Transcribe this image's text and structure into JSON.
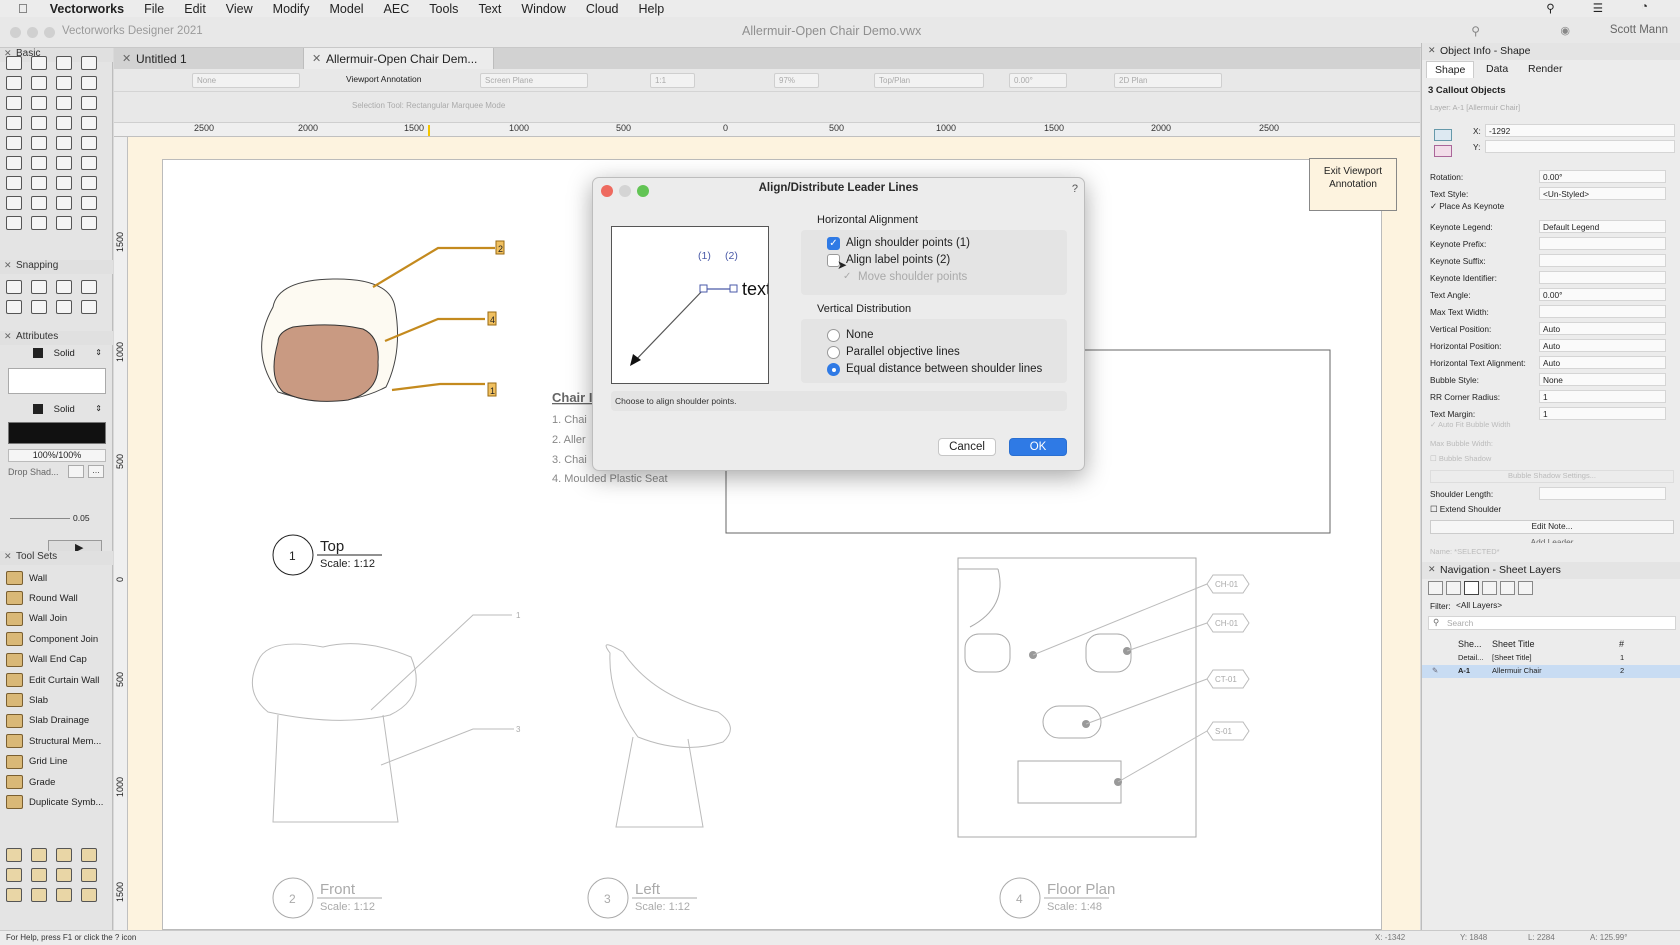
{
  "menubar": {
    "app": "Vectorworks",
    "items": [
      "File",
      "Edit",
      "View",
      "Modify",
      "Model",
      "AEC",
      "Tools",
      "Text",
      "Window",
      "Cloud",
      "Help"
    ]
  },
  "titlebar": {
    "app_title": "Vectorworks Designer 2021",
    "doc_title": "Allermuir-Open Chair Demo.vwx",
    "user": "Scott Mann"
  },
  "tabs": [
    "Untitled 1",
    "Allermuir-Open Chair Dem..."
  ],
  "toolbar": {
    "class_field": "None",
    "viewport_annotation": "Viewport Annotation",
    "plane_field": "Screen Plane",
    "scale_field": "1:1",
    "zoom_field": "97%",
    "view_field": "Top/Plan",
    "rotation_field": "0.00°",
    "render_field": "2D Plan",
    "mode_text": "Selection Tool: Rectangular Marquee Mode"
  },
  "ruler": {
    "h": [
      "2500",
      "2000",
      "1500",
      "1000",
      "500",
      "0",
      "500",
      "1000",
      "1500",
      "2000",
      "2500"
    ],
    "v": [
      "1500",
      "1000",
      "500",
      "0",
      "500",
      "1000",
      "1500"
    ]
  },
  "left_palette": {
    "basic_title": "Basic",
    "snapping_title": "Snapping",
    "attributes_title": "Attributes",
    "fill_style": "Solid",
    "pen_style": "Solid",
    "opacity": "100%/100%",
    "drop_shadow": "Drop Shad...",
    "line_weight": "0.05",
    "toolsets_title": "Tool Sets",
    "toolsets": [
      "Wall",
      "Round Wall",
      "Wall Join",
      "Component Join",
      "Wall End Cap",
      "Edit Curtain Wall",
      "Slab",
      "Slab Drainage",
      "Structural Mem...",
      "Grid Line",
      "Grade",
      "Duplicate Symb..."
    ]
  },
  "drawing": {
    "callout_numbers": [
      "2",
      "4",
      "1"
    ],
    "chair_title": "Chair I",
    "list": [
      "1.  Chai",
      "2.  Aller",
      "3.  Chai",
      "4.  Moulded Plastic Seat"
    ],
    "views": [
      {
        "num": "1",
        "name": "Top",
        "scale": "Scale: 1:12"
      },
      {
        "num": "2",
        "name": "Front",
        "scale": "Scale: 1:12"
      },
      {
        "num": "3",
        "name": "Left",
        "scale": "Scale: 1:12"
      },
      {
        "num": "4",
        "name": "Floor Plan",
        "scale": "Scale: 1:48"
      }
    ],
    "front_leaders": [
      "1",
      "3"
    ],
    "floor_tags": [
      "CH-01",
      "CH-01",
      "CT-01",
      "S-01"
    ],
    "exit_button": "Exit Viewport Annotation"
  },
  "dialog": {
    "title": "Align/Distribute Leader Lines",
    "preview_label1": "(1)",
    "preview_label2": "(2)",
    "preview_text": "text",
    "horizontal_title": "Horizontal Alignment",
    "align_shoulder": "Align shoulder points (1)",
    "align_shoulder_checked": true,
    "align_label": "Align label points (2)",
    "align_label_checked": false,
    "move_shoulder": "Move shoulder points",
    "vertical_title": "Vertical Distribution",
    "vertical_options": [
      "None",
      "Parallel objective lines",
      "Equal distance between shoulder lines"
    ],
    "vertical_selected": "Equal distance between shoulder lines",
    "help_text": "Choose to align shoulder points.",
    "cancel": "Cancel",
    "ok": "OK"
  },
  "object_info": {
    "title": "Object Info - Shape",
    "tabs": [
      "Shape",
      "Data",
      "Render"
    ],
    "selection": "3 Callout Objects",
    "layer": "Layer:  A-1 [Allermuir Chair]",
    "x_label": "X:",
    "x_value": "-1292",
    "y_label": "Y:",
    "fields": [
      {
        "label": "Rotation:",
        "value": "0.00°"
      },
      {
        "label": "Text Style:",
        "value": "<Un-Styled>"
      },
      {
        "label": "Keynote Legend:",
        "value": "Default Legend"
      },
      {
        "label": "Keynote Prefix:",
        "value": ""
      },
      {
        "label": "Keynote Suffix:",
        "value": ""
      },
      {
        "label": "Keynote Identifier:",
        "value": ""
      },
      {
        "label": "Text Angle:",
        "value": "0.00°"
      },
      {
        "label": "Max Text Width:",
        "value": ""
      },
      {
        "label": "Vertical Position:",
        "value": "Auto"
      },
      {
        "label": "Horizontal Position:",
        "value": "Auto"
      },
      {
        "label": "Horizontal Text Alignment:",
        "value": "Auto"
      },
      {
        "label": "Bubble Style:",
        "value": "None"
      },
      {
        "label": "RR Corner Radius:",
        "value": "1"
      },
      {
        "label": "Text Margin:",
        "value": "1"
      }
    ],
    "place_as_keynote": "Place As Keynote",
    "auto_fit": "Auto Fit Bubble Width",
    "max_bubble": "Max Bubble Width:",
    "bubble_shadow": "Bubble Shadow",
    "bubble_shadow_settings": "Bubble Shadow Settings...",
    "shoulder_length": "Shoulder Length:",
    "extend_shoulder": "Extend Shoulder",
    "edit_note": "Edit Note...",
    "add_leader": "Add Leader",
    "name_field": "Name:  *SELECTED*"
  },
  "navigation": {
    "title": "Navigation - Sheet Layers",
    "filter_label": "Filter:",
    "filter_value": "<All Layers>",
    "search_placeholder": "Search",
    "col_sheet": "She...",
    "col_title": "Sheet Title",
    "col_num": "#",
    "rows": [
      {
        "sheet": "Detail...",
        "title": "[Sheet Title]",
        "num": "1"
      },
      {
        "sheet": "A-1",
        "title": "Allermuir Chair",
        "num": "2"
      }
    ]
  },
  "status": {
    "help": "For Help, press F1 or click the ? icon",
    "x": "X: -1342",
    "y": "Y: 1848",
    "l": "L: 2284",
    "a": "A: 125.99°"
  }
}
